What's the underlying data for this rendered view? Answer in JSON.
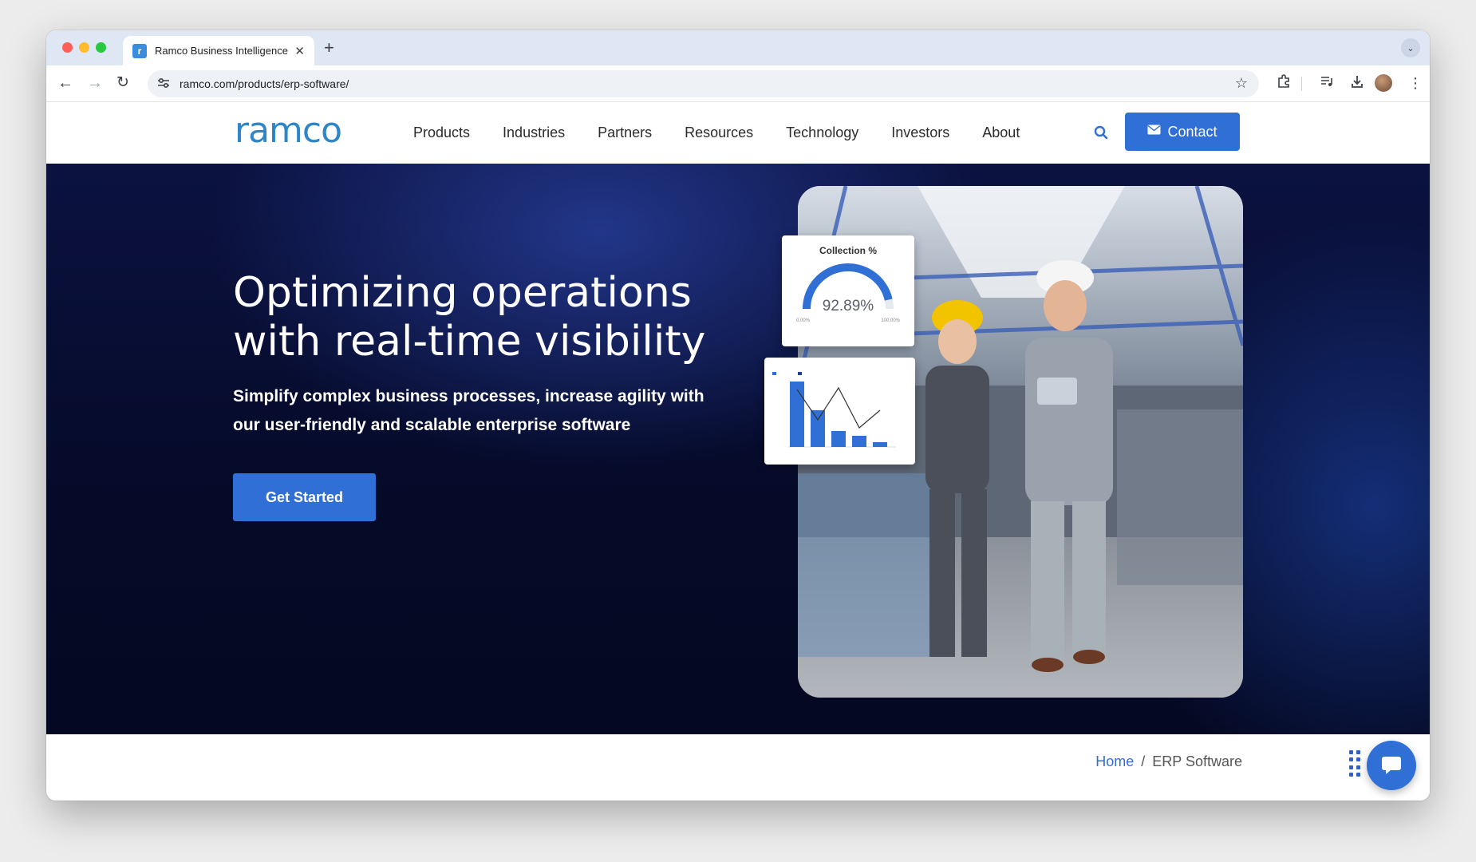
{
  "browser": {
    "tab_title": "Ramco Business Intelligence",
    "tab_favicon": "ramco-favicon",
    "url": "ramco.com/products/erp-software/"
  },
  "header": {
    "logo_text": "ramco",
    "nav": [
      "Products",
      "Industries",
      "Partners",
      "Resources",
      "Technology",
      "Investors",
      "About"
    ],
    "contact_label": "Contact"
  },
  "hero": {
    "title_line1": "Optimizing operations",
    "title_line2": "with real-time visibility",
    "subtitle_line1": "Simplify complex business processes, increase agility with",
    "subtitle_line2": "our user-friendly and scalable enterprise software",
    "cta_label": "Get Started",
    "gauge_card": {
      "title": "Collection %",
      "value": "92.89%",
      "min_label": "0.00%",
      "max_label": "100.00%",
      "fraction": 0.9289
    }
  },
  "footer": {
    "breadcrumb_home": "Home",
    "breadcrumb_separator": "/",
    "breadcrumb_current": "ERP Software"
  },
  "colors": {
    "brand_blue": "#2f6fd6",
    "logo_blue": "#2e86c9",
    "hero_dark": "#050a28"
  },
  "icons": [
    "back-arrow-icon",
    "forward-arrow-icon",
    "reload-icon",
    "site-info-icon",
    "star-icon",
    "extensions-icon",
    "media-icon",
    "download-icon",
    "kebab-menu-icon",
    "search-icon",
    "envelope-icon",
    "grid-dots-icon",
    "chat-icon"
  ]
}
